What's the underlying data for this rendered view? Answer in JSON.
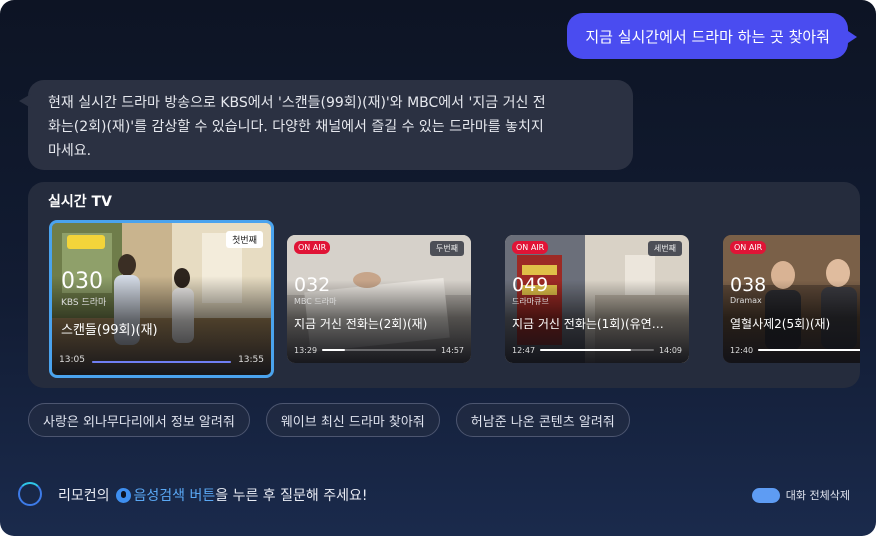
{
  "user_message": "지금 실시간에서 드라마 하는 곳 찾아줘",
  "assistant_lines": [
    "현재 실시간 드라마 방송으로 KBS에서 '스캔들(99회)(재)'와 MBC에서 '지금 거신 전",
    "화는(2회)(재)'를 감상할 수 있습니다. 다양한 채널에서 즐길 수 있는 드라마를 놓치지",
    "마세요."
  ],
  "live_section": {
    "title": "실시간 TV",
    "cards": [
      {
        "badge": "첫번째",
        "onair": "",
        "number": "030",
        "channel": "KBS 드라마",
        "program": "스캔들(99회)(재)",
        "start": "13:05",
        "end": "13:55",
        "progress": 1.0,
        "selected": true
      },
      {
        "badge": "두번째",
        "onair": "ON AIR",
        "number": "032",
        "channel": "MBC 드라마",
        "program": "지금 거신 전화는(2회)(재)",
        "start": "13:29",
        "end": "14:57",
        "progress": 0.2,
        "selected": false
      },
      {
        "badge": "세번째",
        "onair": "ON AIR",
        "number": "049",
        "channel": "드라마큐브",
        "program": "지금 거신 전화는(1회)(유연…",
        "start": "12:47",
        "end": "14:09",
        "progress": 0.8,
        "selected": false
      },
      {
        "badge": "",
        "onair": "ON AIR",
        "number": "038",
        "channel": "Dramax",
        "program": "열혈사제2(5회)(재)",
        "start": "12:40",
        "end": "",
        "progress": 1.0,
        "selected": false
      }
    ]
  },
  "suggestions": [
    "사랑은 외나무다리에서 정보 알려줘",
    "웨이브 최신 드라마 찾아줘",
    "허남준 나온 콘텐츠 알려줘"
  ],
  "footer": {
    "prefix": "리모컨의",
    "voice_button": "음성검색 버튼",
    "suffix": "을 누른 후 질문해 주세요!",
    "delete_all": "대화 전체삭제"
  },
  "colors": {
    "accent": "#4a4cf0",
    "onair": "#e01436",
    "selected_border": "#4aa3ee"
  }
}
